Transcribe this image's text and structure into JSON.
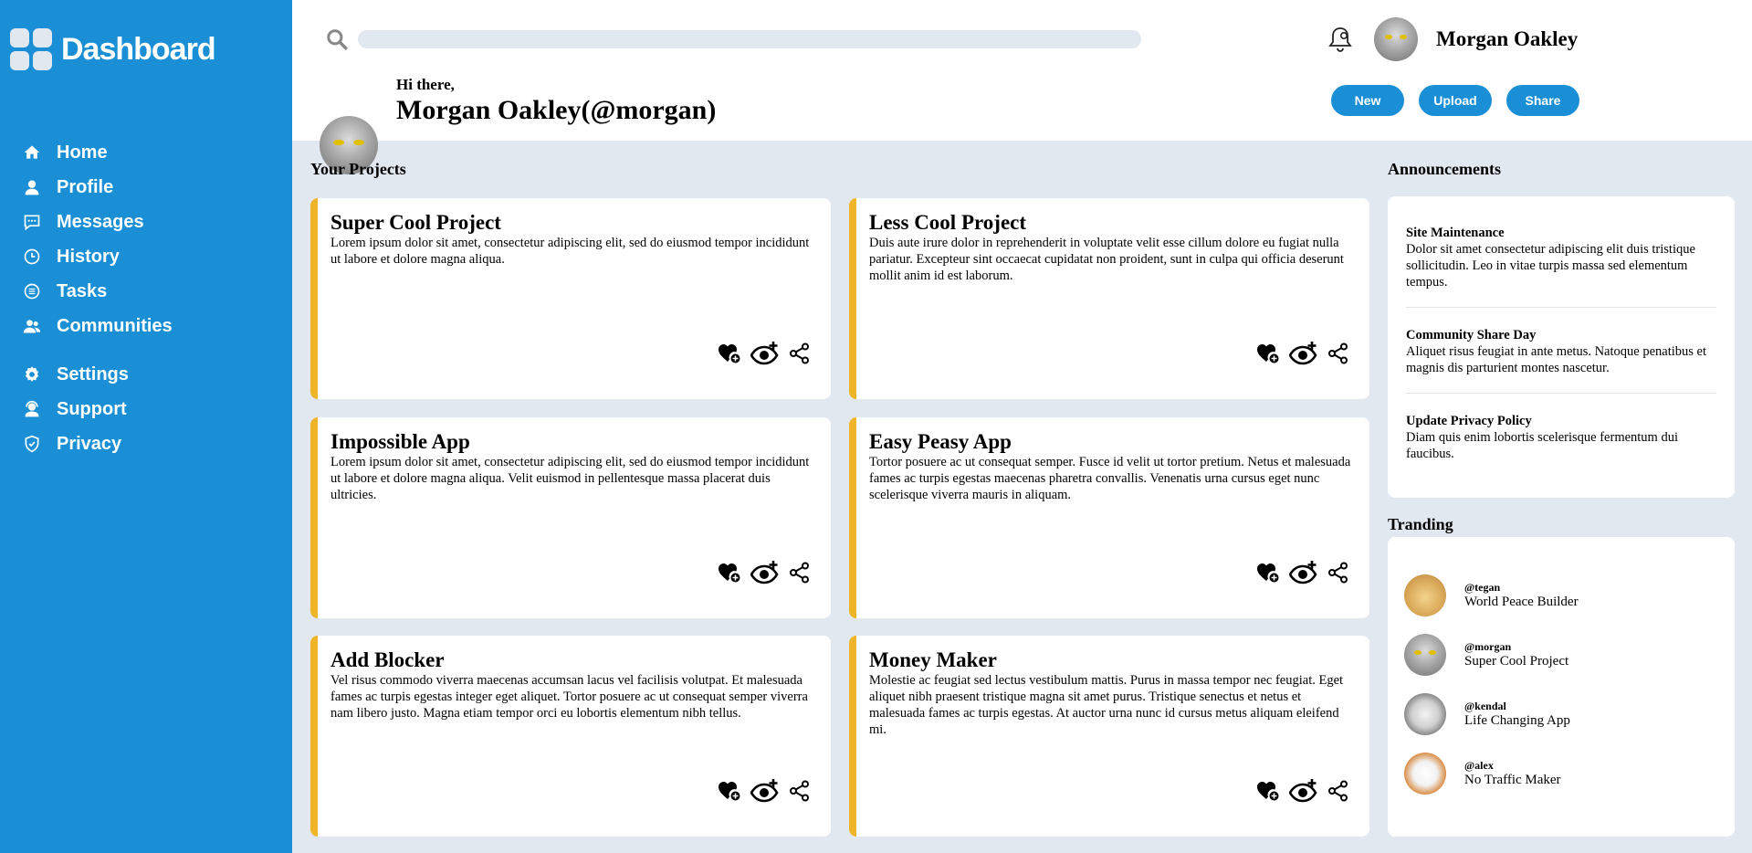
{
  "sidebar": {
    "brand": "Dashboard",
    "items": [
      {
        "label": "Home"
      },
      {
        "label": "Profile"
      },
      {
        "label": "Messages"
      },
      {
        "label": "History"
      },
      {
        "label": "Tasks"
      },
      {
        "label": "Communities"
      },
      {
        "label": "Settings"
      },
      {
        "label": "Support"
      },
      {
        "label": "Privacy"
      }
    ]
  },
  "header": {
    "search_placeholder": "",
    "user_name": "Morgan Oakley",
    "greeting": "Hi there,",
    "display_name": "Morgan Oakley(@morgan)",
    "buttons": {
      "new": "New",
      "upload": "Upload",
      "share": "Share"
    }
  },
  "projects": {
    "title": "Your Projects",
    "items": [
      {
        "title": "Super Cool Project",
        "desc": "Lorem ipsum dolor sit amet, consectetur adipiscing elit, sed do eiusmod tempor incididunt ut labore et dolore magna aliqua."
      },
      {
        "title": "Less Cool Project",
        "desc": "Duis aute irure dolor in reprehenderit in voluptate velit esse cillum dolore eu fugiat nulla pariatur. Excepteur sint occaecat cupidatat non proident, sunt in culpa qui officia deserunt mollit anim id est laborum."
      },
      {
        "title": "Impossible App",
        "desc": "Lorem ipsum dolor sit amet, consectetur adipiscing elit, sed do eiusmod tempor incididunt ut labore et dolore magna aliqua. Velit euismod in pellentesque massa placerat duis ultricies."
      },
      {
        "title": "Easy Peasy App",
        "desc": "Tortor posuere ac ut consequat semper. Fusce id velit ut tortor pretium. Netus et malesuada fames ac turpis egestas maecenas pharetra convallis. Venenatis urna cursus eget nunc scelerisque viverra mauris in aliquam."
      },
      {
        "title": "Add Blocker",
        "desc": "Vel risus commodo viverra maecenas accumsan lacus vel facilisis volutpat. Et malesuada fames ac turpis egestas integer eget aliquet. Tortor posuere ac ut consequat semper viverra nam libero justo. Magna etiam tempor orci eu lobortis elementum nibh tellus."
      },
      {
        "title": "Money Maker",
        "desc": "Molestie ac feugiat sed lectus vestibulum mattis. Purus in massa tempor nec feugiat. Eget aliquet nibh praesent tristique magna sit amet purus. Tristique senectus et netus et malesuada fames ac turpis egestas. At auctor urna nunc id cursus metus aliquam eleifend mi."
      }
    ]
  },
  "announcements": {
    "title": "Announcements",
    "items": [
      {
        "title": "Site Maintenance",
        "body": "Dolor sit amet consectetur adipiscing elit duis tristique sollicitudin. Leo in vitae turpis massa sed elementum tempus."
      },
      {
        "title": "Community Share Day",
        "body": "Aliquet risus feugiat in ante metus. Natoque penatibus et magnis dis parturient montes nascetur."
      },
      {
        "title": "Update Privacy Policy",
        "body": "Diam quis enim lobortis scelerisque fermentum dui faucibus."
      }
    ]
  },
  "trending": {
    "title": "Tranding",
    "items": [
      {
        "handle": "@tegan",
        "project": "World Peace Builder"
      },
      {
        "handle": "@morgan",
        "project": "Super Cool Project"
      },
      {
        "handle": "@kendal",
        "project": "Life Changing App"
      },
      {
        "handle": "@alex",
        "project": "No Traffic Maker"
      }
    ]
  },
  "colors": {
    "primary": "#1a8fd6",
    "accent": "#f0b429",
    "background": "#e2e8f0"
  }
}
